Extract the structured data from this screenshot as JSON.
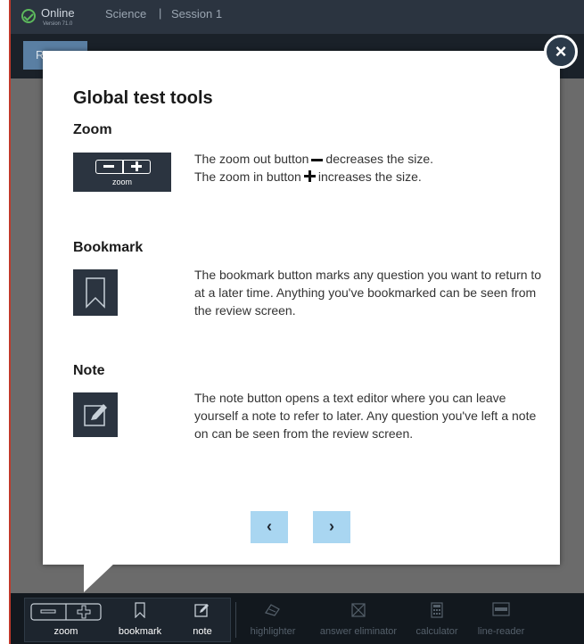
{
  "header": {
    "status": "Online",
    "version": "Version 71.0",
    "subject": "Science",
    "separator": "|",
    "session": "Session 1",
    "status_color": "#5cb85c"
  },
  "subbar": {
    "review_label": "R"
  },
  "dialog": {
    "title": "Global test tools",
    "close_icon": "close-icon",
    "sections": {
      "zoom": {
        "heading": "Zoom",
        "sample_caption": "zoom",
        "line1_before": "The zoom out button",
        "line1_after": "decreases the size.",
        "line2_before": "The zoom in button",
        "line2_after": "increases the size."
      },
      "bookmark": {
        "heading": "Bookmark",
        "text": "The bookmark button marks any question you want to return to at a later time. Anything you've bookmarked can be seen from the review screen."
      },
      "note": {
        "heading": "Note",
        "text": "The note button opens a text editor where you can leave yourself a note to refer to later. Any question you've left a note on can be seen from the review screen."
      }
    },
    "nav": {
      "prev": "‹",
      "next": "›",
      "accent": "#a9d6f1"
    }
  },
  "toolbar": {
    "tools": [
      {
        "label": "zoom",
        "icon": "zoom-controls-icon",
        "state": "active"
      },
      {
        "label": "bookmark",
        "icon": "bookmark-icon",
        "state": "active"
      },
      {
        "label": "note",
        "icon": "note-icon",
        "state": "active"
      },
      {
        "label": "highlighter",
        "icon": "highlighter-icon",
        "state": "disabled"
      },
      {
        "label": "answer eliminator",
        "icon": "answer-eliminator-icon",
        "state": "disabled"
      },
      {
        "label": "calculator",
        "icon": "calculator-icon",
        "state": "disabled"
      },
      {
        "label": "line-reader",
        "icon": "line-reader-icon",
        "state": "disabled"
      }
    ]
  }
}
